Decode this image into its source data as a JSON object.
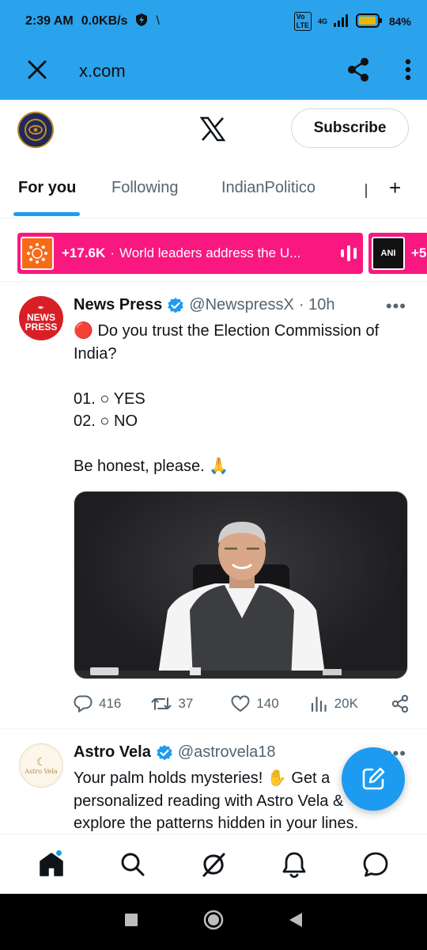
{
  "status_bar": {
    "time": "2:39 AM",
    "speed": "0.0KB/s",
    "battery": "84%",
    "network": "4G"
  },
  "browser": {
    "url": "x.com"
  },
  "header": {
    "subscribe_label": "Subscribe"
  },
  "tabs": [
    {
      "label": "For you",
      "active": true
    },
    {
      "label": "Following",
      "active": false
    },
    {
      "label": "IndianPolitico",
      "active": false
    }
  ],
  "spaces": [
    {
      "count": "+17.6K",
      "separator": "·",
      "title": "World leaders address the U..."
    },
    {
      "count": "+5",
      "thumb_text": "ANI"
    }
  ],
  "tweet1": {
    "avatar_text_1": "NEWS",
    "avatar_text_2": "PRESS",
    "name": "News Press",
    "handle": "@NewspressX",
    "time": "· 10h",
    "lines": [
      "🔴 Do you trust the Election Commission of India?",
      "",
      "01. ○ YES",
      "02. ○ NO",
      "",
      "Be honest, please. 🙏"
    ],
    "replies": "416",
    "reposts": "37",
    "likes": "140",
    "views": "20K"
  },
  "tweet2": {
    "avatar_text": "Astro Vela",
    "name": "Astro Vela",
    "handle": "@astrovela18",
    "lines": [
      "Your palm holds mysteries! ✋ Get a",
      "personalized reading with Astro Vela &",
      "explore the patterns hidden in your lines."
    ]
  },
  "colors": {
    "browser_bar": "#2aa3ec",
    "accent": "#1d9bf0",
    "spaces_pink": "#f91880",
    "muted_text": "#536471"
  },
  "icons": {
    "browser": [
      "close-icon",
      "share-icon",
      "more-vertical-icon"
    ],
    "nav": [
      "home-icon",
      "search-icon",
      "grok-icon",
      "notifications-icon",
      "messages-icon"
    ]
  }
}
